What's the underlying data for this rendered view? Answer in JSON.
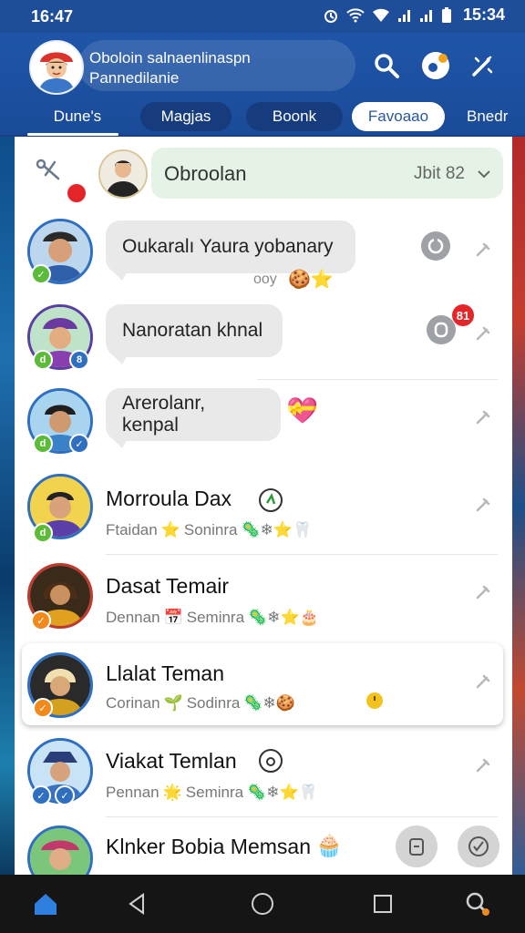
{
  "status_bar": {
    "time_left": "16:47",
    "time_right": "15:34"
  },
  "header": {
    "title_line1": "Oboloin salnaenlinaspn",
    "title_line2": "Pannedilanie"
  },
  "tabs": [
    {
      "label": "Dune's"
    },
    {
      "label": "Magjas"
    },
    {
      "label": "Boonk"
    },
    {
      "label": "Favoaao"
    },
    {
      "label": "Bnedr"
    }
  ],
  "group": {
    "name": "Obroolan",
    "meta": "Jbit 82"
  },
  "chats": [
    {
      "text": "Oukaralı Yaura yobanary",
      "reaction_text": "ooy",
      "badge": ""
    },
    {
      "text": "Nanoratan khnal",
      "badge": ""
    },
    {
      "text": "Arerolanr, kenpal"
    },
    {
      "name": "Morroula Dax",
      "sub1": "Ftaidan",
      "sub2": "Soninra"
    },
    {
      "name": "Dasat Temair",
      "sub1": "Dennan",
      "sub2": "Seminra"
    },
    {
      "name": "Llalat Teman",
      "sub1": "Corinan",
      "sub2": "Sodinra"
    },
    {
      "name": "Viakat Temlan",
      "sub1": "Pennan",
      "sub2": "Seminra"
    },
    {
      "name": "Klnker Bobia Memsan"
    }
  ],
  "colors": {
    "header_blue": "#1f55a8",
    "accent_red": "#e4262b",
    "green_badge": "#5dbb3a",
    "orange_badge": "#f08a1c"
  }
}
